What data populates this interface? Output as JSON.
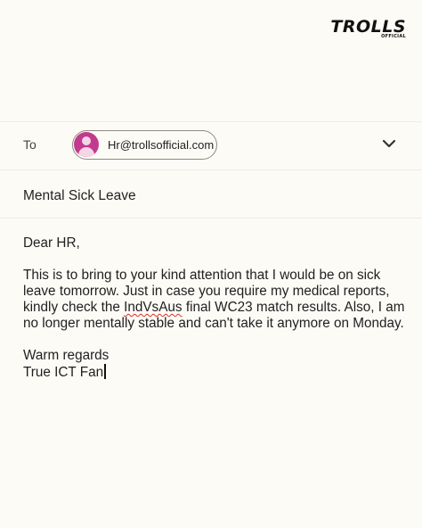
{
  "brand": {
    "logo_text": "TROLLS",
    "logo_subtext": "OFFICIAL"
  },
  "compose": {
    "to_label": "To",
    "recipient": "Hr@trollsofficial.com",
    "subject": "Mental Sick Leave",
    "body": {
      "greeting": "Dear HR,",
      "para_part1": "This is to bring to your kind attention that I would be on sick leave tomorrow. Just in case you require my medical reports, kindly check the ",
      "para_misspelled": "IndVsAus",
      "para_part2": " final WC23 match results. Also, I am no longer mentally stable and can't take it anymore on Monday.",
      "closing": "Warm regards",
      "signature": "True ICT Fan"
    }
  },
  "icons": {
    "avatar": "person-icon",
    "expand": "chevron-down-icon"
  },
  "colors": {
    "avatar_bg": "#c23a8e",
    "background": "#fdfbf6",
    "spellcheck": "#d93025"
  }
}
